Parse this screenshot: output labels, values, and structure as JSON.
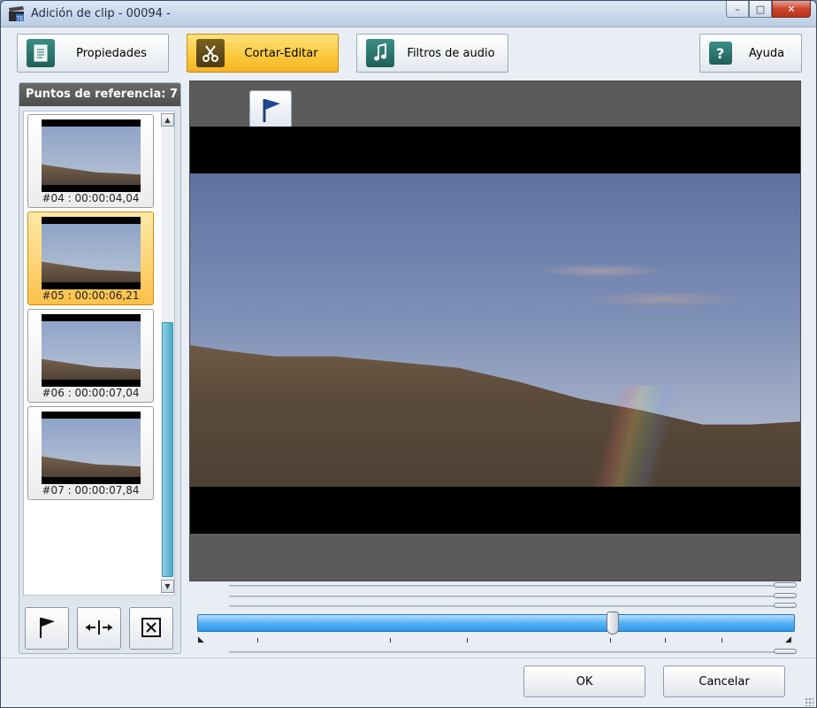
{
  "window": {
    "title": "Adición de clip - 00094 -",
    "controls": {
      "minimize": "–",
      "maximize": "□",
      "close": "✕"
    }
  },
  "tabs": [
    {
      "label": "Propiedades",
      "icon": "document-icon",
      "active": false
    },
    {
      "label": "Cortar-Editar",
      "icon": "scissors-icon",
      "active": true
    },
    {
      "label": "Filtros de audio",
      "icon": "music-note-icon",
      "active": false
    }
  ],
  "help": {
    "label": "Ayuda",
    "icon": "question-icon"
  },
  "reference_points": {
    "header": "Puntos de referencia: 7",
    "items": [
      {
        "caption": "#04 : 00:00:04,04",
        "selected": false
      },
      {
        "caption": "#05 : 00:00:06,21",
        "selected": true
      },
      {
        "caption": "#06 : 00:00:07,04",
        "selected": false
      },
      {
        "caption": "#07 : 00:00:07,84",
        "selected": false
      }
    ],
    "scroll_up": "▲",
    "scroll_down": "▼",
    "actions": [
      {
        "name": "add-marker-button",
        "icon": "flag-icon"
      },
      {
        "name": "split-button",
        "icon": "split-arrows-icon"
      },
      {
        "name": "delete-marker-button",
        "icon": "delete-box-icon"
      }
    ]
  },
  "playback": {
    "position_fraction": 0.695
  },
  "footer": {
    "ok_label": "OK",
    "cancel_label": "Cancelar"
  },
  "colors": {
    "accent": "#fbc83a",
    "timeline": "#4aa9ef",
    "video_bg": "#5b5b5b"
  }
}
